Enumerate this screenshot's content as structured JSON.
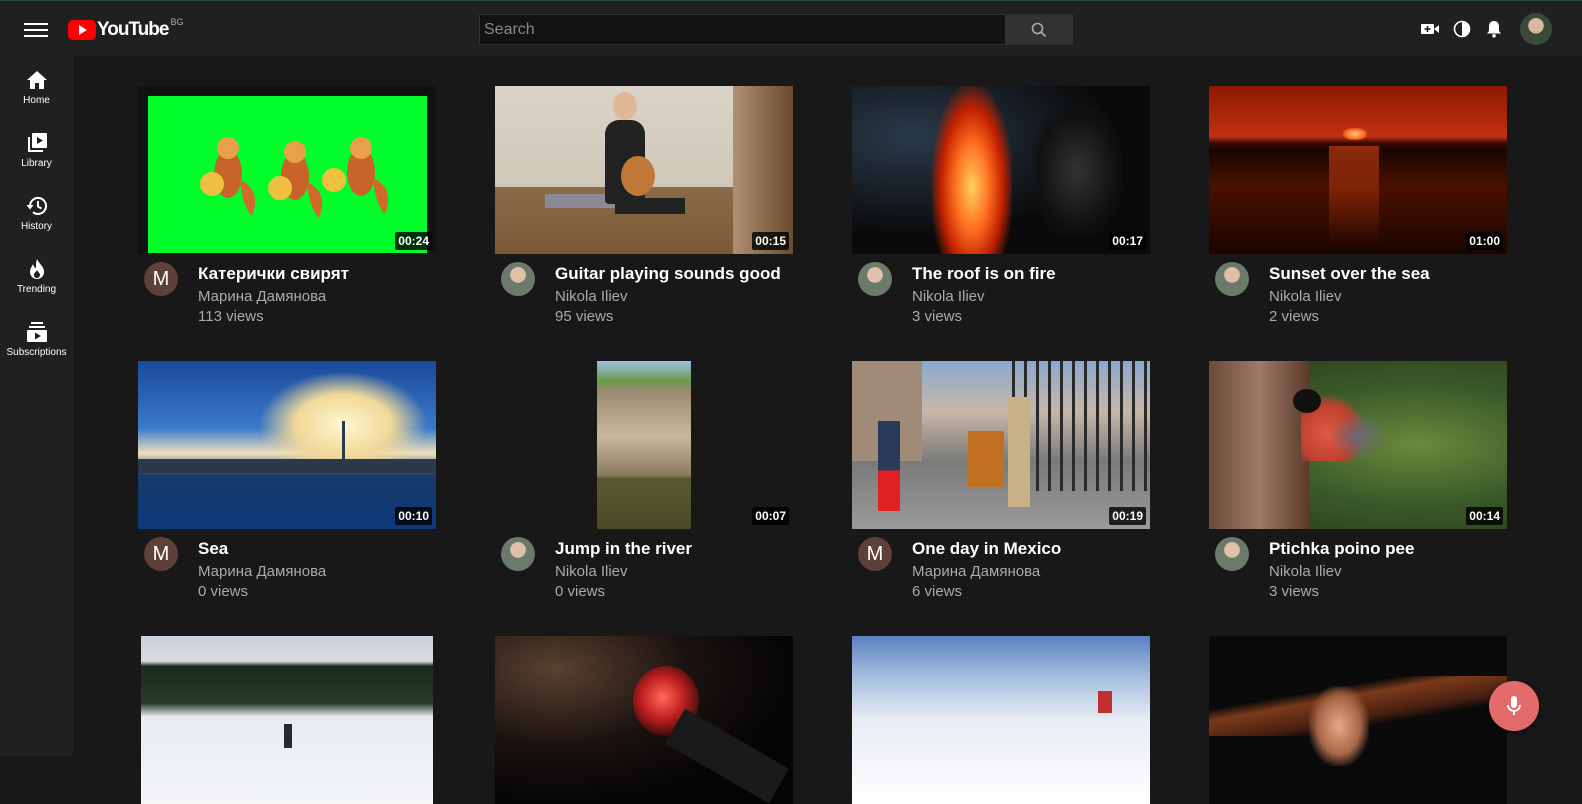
{
  "header": {
    "logo_text": "YouTube",
    "logo_country": "BG",
    "search_placeholder": "Search"
  },
  "sidebar": {
    "items": [
      {
        "label": "Home",
        "icon": "home-icon"
      },
      {
        "label": "Library",
        "icon": "library-icon"
      },
      {
        "label": "History",
        "icon": "history-icon"
      },
      {
        "label": "Trending",
        "icon": "trending-icon"
      },
      {
        "label": "Subscriptions",
        "icon": "subscriptions-icon"
      }
    ]
  },
  "videos": [
    {
      "title": "Катерички свирят",
      "channel": "Марина Дамянова",
      "views": "113 views",
      "duration": "00:24"
    },
    {
      "title": "Guitar playing sounds good",
      "channel": "Nikola Iliev",
      "views": "95 views",
      "duration": "00:15"
    },
    {
      "title": "The roof is on fire",
      "channel": "Nikola Iliev",
      "views": "3 views",
      "duration": "00:17"
    },
    {
      "title": "Sunset over the sea",
      "channel": "Nikola Iliev",
      "views": "2 views",
      "duration": "01:00"
    },
    {
      "title": "Sea",
      "channel": "Марина Дамянова",
      "views": "0 views",
      "duration": "00:10"
    },
    {
      "title": "Jump in the river",
      "channel": "Nikola Iliev",
      "views": "0 views",
      "duration": "00:07"
    },
    {
      "title": "One day in Mexico",
      "channel": "Марина Дамянова",
      "views": "6 views",
      "duration": "00:19"
    },
    {
      "title": "Ptichka poino pee",
      "channel": "Nikola Iliev",
      "views": "3 views",
      "duration": "00:14"
    }
  ],
  "avatar_letter": "M",
  "colors": {
    "background": "#181818",
    "surface": "#202020",
    "brand_red": "#ff0000",
    "mic_button": "#e36b6b"
  }
}
